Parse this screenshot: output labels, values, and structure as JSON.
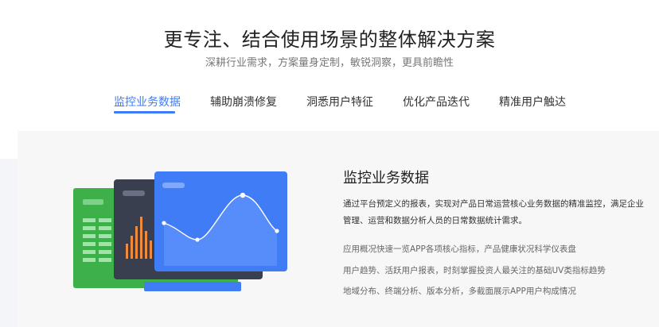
{
  "hero": {
    "title": "更专注、结合使用场景的整体解决方案",
    "subtitle": "深耕行业需求，方案量身定制，敏锐洞察，更具前瞻性"
  },
  "tabs": [
    {
      "label": "监控业务数据",
      "active": true
    },
    {
      "label": "辅助崩溃修复",
      "active": false
    },
    {
      "label": "洞悉用户特征",
      "active": false
    },
    {
      "label": "优化产品迭代",
      "active": false
    },
    {
      "label": "精准用户触达",
      "active": false
    }
  ],
  "detail": {
    "title": "监控业务数据",
    "description": "通过平台预定义的报表，实现对产品日常运营核心业务数据的精准监控，满足企业管理、运营和数据分析人员的日常数据统计需求。",
    "features": [
      "应用概况快速一览APP各项核心指标，产品健康状况科学仪表盘",
      "用户趋势、活跃用户报表，时刻掌握投资人最关注的基础UV类指标趋势",
      "地域分布、终端分析、版本分析，多截面展示APP用户构成情况"
    ]
  },
  "colors": {
    "accent": "#3d7cf7",
    "card_green": "#3db04a",
    "card_dark": "#3a3f4f",
    "card_blue": "#3f7cf6",
    "bars_orange": "#f08a3c"
  }
}
